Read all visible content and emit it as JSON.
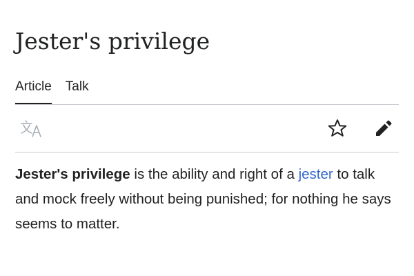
{
  "article": {
    "title": "Jester's privilege"
  },
  "tabs": [
    {
      "label": "Article",
      "active": true
    },
    {
      "label": "Talk",
      "active": false
    }
  ],
  "toolbar": {
    "language_icon": "translate-icon",
    "watch_icon": "star-icon",
    "edit_icon": "pencil-icon"
  },
  "lead": {
    "bold_term": "Jester's privilege",
    "text_before_link": " is the ability and right of a ",
    "link_text": "jester",
    "text_after_link": " to talk and mock freely without being punished; for nothing he says seems to matter."
  },
  "colors": {
    "text": "#202122",
    "link": "#3366cc",
    "divider": "#c8ccd1",
    "icon_muted": "#a2a9b1"
  }
}
